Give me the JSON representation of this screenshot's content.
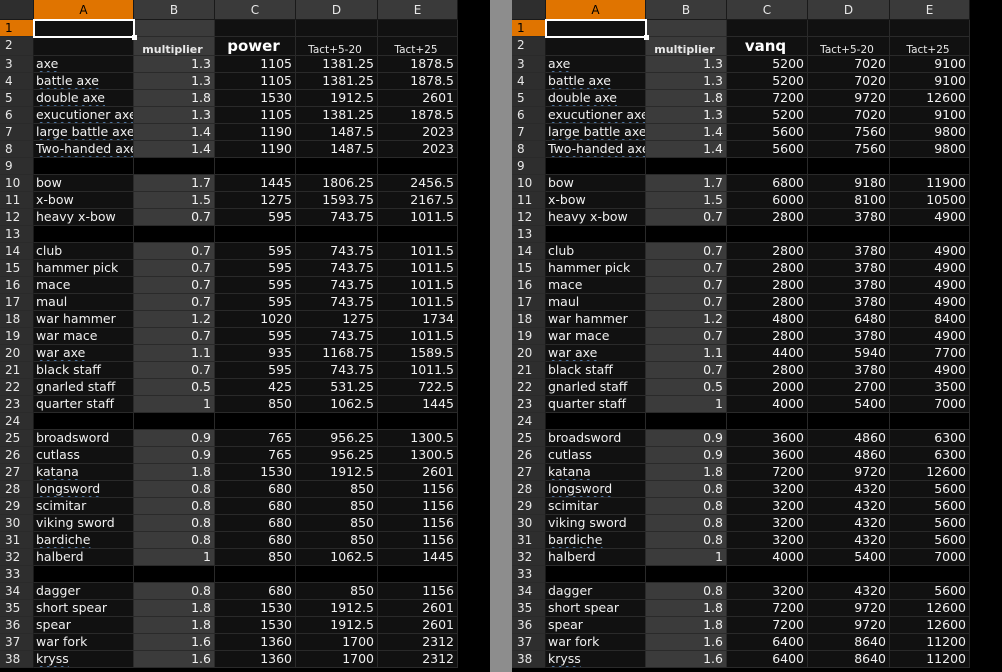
{
  "columns": [
    "A",
    "B",
    "C",
    "D",
    "E"
  ],
  "left": {
    "headers": {
      "b": "multiplier",
      "c": "power",
      "d": "Tact+5-20",
      "e": "Tact+25"
    },
    "rows": [
      {
        "n": "1",
        "a": "",
        "b": "",
        "c": "",
        "d": "",
        "e": ""
      },
      {
        "n": "2",
        "a": "",
        "b": "",
        "c": "",
        "d": "",
        "e": ""
      },
      {
        "n": "3",
        "a": "axe",
        "b": "1.3",
        "c": "1105",
        "d": "1381.25",
        "e": "1878.5",
        "sq": true
      },
      {
        "n": "4",
        "a": "battle axe",
        "b": "1.3",
        "c": "1105",
        "d": "1381.25",
        "e": "1878.5",
        "sq": true
      },
      {
        "n": "5",
        "a": "double axe",
        "b": "1.8",
        "c": "1530",
        "d": "1912.5",
        "e": "2601",
        "sq": true
      },
      {
        "n": "6",
        "a": "exucutioner axe",
        "b": "1.3",
        "c": "1105",
        "d": "1381.25",
        "e": "1878.5",
        "sq": true
      },
      {
        "n": "7",
        "a": "large battle axe",
        "b": "1.4",
        "c": "1190",
        "d": "1487.5",
        "e": "2023",
        "sq": true
      },
      {
        "n": "8",
        "a": "Two-handed axe",
        "b": "1.4",
        "c": "1190",
        "d": "1487.5",
        "e": "2023",
        "sq": true
      },
      {
        "n": "9",
        "a": "",
        "b": "",
        "c": "",
        "d": "",
        "e": "",
        "blank": true
      },
      {
        "n": "10",
        "a": "bow",
        "b": "1.7",
        "c": "1445",
        "d": "1806.25",
        "e": "2456.5"
      },
      {
        "n": "11",
        "a": "x-bow",
        "b": "1.5",
        "c": "1275",
        "d": "1593.75",
        "e": "2167.5"
      },
      {
        "n": "12",
        "a": "heavy x-bow",
        "b": "0.7",
        "c": "595",
        "d": "743.75",
        "e": "1011.5"
      },
      {
        "n": "13",
        "a": "",
        "b": "",
        "c": "",
        "d": "",
        "e": "",
        "blank": true
      },
      {
        "n": "14",
        "a": "club",
        "b": "0.7",
        "c": "595",
        "d": "743.75",
        "e": "1011.5"
      },
      {
        "n": "15",
        "a": "hammer pick",
        "b": "0.7",
        "c": "595",
        "d": "743.75",
        "e": "1011.5"
      },
      {
        "n": "16",
        "a": "mace",
        "b": "0.7",
        "c": "595",
        "d": "743.75",
        "e": "1011.5"
      },
      {
        "n": "17",
        "a": "maul",
        "b": "0.7",
        "c": "595",
        "d": "743.75",
        "e": "1011.5"
      },
      {
        "n": "18",
        "a": "war hammer",
        "b": "1.2",
        "c": "1020",
        "d": "1275",
        "e": "1734"
      },
      {
        "n": "19",
        "a": "war mace",
        "b": "0.7",
        "c": "595",
        "d": "743.75",
        "e": "1011.5"
      },
      {
        "n": "20",
        "a": "war axe",
        "b": "1.1",
        "c": "935",
        "d": "1168.75",
        "e": "1589.5",
        "sq": true
      },
      {
        "n": "21",
        "a": "black staff",
        "b": "0.7",
        "c": "595",
        "d": "743.75",
        "e": "1011.5"
      },
      {
        "n": "22",
        "a": "gnarled staff",
        "b": "0.5",
        "c": "425",
        "d": "531.25",
        "e": "722.5"
      },
      {
        "n": "23",
        "a": "quarter staff",
        "b": "1",
        "c": "850",
        "d": "1062.5",
        "e": "1445"
      },
      {
        "n": "24",
        "a": "",
        "b": "",
        "c": "",
        "d": "",
        "e": "",
        "blank": true
      },
      {
        "n": "25",
        "a": "broadsword",
        "b": "0.9",
        "c": "765",
        "d": "956.25",
        "e": "1300.5"
      },
      {
        "n": "26",
        "a": "cutlass",
        "b": "0.9",
        "c": "765",
        "d": "956.25",
        "e": "1300.5"
      },
      {
        "n": "27",
        "a": "katana",
        "b": "1.8",
        "c": "1530",
        "d": "1912.5",
        "e": "2601",
        "sq": true
      },
      {
        "n": "28",
        "a": "longsword",
        "b": "0.8",
        "c": "680",
        "d": "850",
        "e": "1156",
        "sq": true
      },
      {
        "n": "29",
        "a": "scimitar",
        "b": "0.8",
        "c": "680",
        "d": "850",
        "e": "1156"
      },
      {
        "n": "30",
        "a": "viking sword",
        "b": "0.8",
        "c": "680",
        "d": "850",
        "e": "1156"
      },
      {
        "n": "31",
        "a": "bardiche",
        "b": "0.8",
        "c": "680",
        "d": "850",
        "e": "1156",
        "sq": true
      },
      {
        "n": "32",
        "a": "halberd",
        "b": "1",
        "c": "850",
        "d": "1062.5",
        "e": "1445"
      },
      {
        "n": "33",
        "a": "",
        "b": "",
        "c": "",
        "d": "",
        "e": "",
        "blank": true
      },
      {
        "n": "34",
        "a": "dagger",
        "b": "0.8",
        "c": "680",
        "d": "850",
        "e": "1156"
      },
      {
        "n": "35",
        "a": "short spear",
        "b": "1.8",
        "c": "1530",
        "d": "1912.5",
        "e": "2601"
      },
      {
        "n": "36",
        "a": "spear",
        "b": "1.8",
        "c": "1530",
        "d": "1912.5",
        "e": "2601"
      },
      {
        "n": "37",
        "a": "war fork",
        "b": "1.6",
        "c": "1360",
        "d": "1700",
        "e": "2312"
      },
      {
        "n": "38",
        "a": "kryss",
        "b": "1.6",
        "c": "1360",
        "d": "1700",
        "e": "2312",
        "sq": true
      }
    ]
  },
  "right": {
    "headers": {
      "b": "multiplier",
      "c": "vanq",
      "d": "Tact+5-20",
      "e": "Tact+25"
    },
    "rows": [
      {
        "n": "1",
        "a": "",
        "b": "",
        "c": "",
        "d": "",
        "e": ""
      },
      {
        "n": "2",
        "a": "",
        "b": "",
        "c": "",
        "d": "",
        "e": ""
      },
      {
        "n": "3",
        "a": "axe",
        "b": "1.3",
        "c": "5200",
        "d": "7020",
        "e": "9100",
        "sq": true
      },
      {
        "n": "4",
        "a": "battle axe",
        "b": "1.3",
        "c": "5200",
        "d": "7020",
        "e": "9100",
        "sq": true
      },
      {
        "n": "5",
        "a": "double axe",
        "b": "1.8",
        "c": "7200",
        "d": "9720",
        "e": "12600",
        "sq": true
      },
      {
        "n": "6",
        "a": "exucutioner axe",
        "b": "1.3",
        "c": "5200",
        "d": "7020",
        "e": "9100",
        "sq": true
      },
      {
        "n": "7",
        "a": "large battle axe",
        "b": "1.4",
        "c": "5600",
        "d": "7560",
        "e": "9800",
        "sq": true
      },
      {
        "n": "8",
        "a": "Two-handed axe",
        "b": "1.4",
        "c": "5600",
        "d": "7560",
        "e": "9800",
        "sq": true
      },
      {
        "n": "9",
        "a": "",
        "b": "",
        "c": "",
        "d": "",
        "e": "",
        "blank": true
      },
      {
        "n": "10",
        "a": "bow",
        "b": "1.7",
        "c": "6800",
        "d": "9180",
        "e": "11900"
      },
      {
        "n": "11",
        "a": "x-bow",
        "b": "1.5",
        "c": "6000",
        "d": "8100",
        "e": "10500"
      },
      {
        "n": "12",
        "a": "heavy x-bow",
        "b": "0.7",
        "c": "2800",
        "d": "3780",
        "e": "4900"
      },
      {
        "n": "13",
        "a": "",
        "b": "",
        "c": "",
        "d": "",
        "e": "",
        "blank": true
      },
      {
        "n": "14",
        "a": "club",
        "b": "0.7",
        "c": "2800",
        "d": "3780",
        "e": "4900"
      },
      {
        "n": "15",
        "a": "hammer pick",
        "b": "0.7",
        "c": "2800",
        "d": "3780",
        "e": "4900"
      },
      {
        "n": "16",
        "a": "mace",
        "b": "0.7",
        "c": "2800",
        "d": "3780",
        "e": "4900"
      },
      {
        "n": "17",
        "a": "maul",
        "b": "0.7",
        "c": "2800",
        "d": "3780",
        "e": "4900"
      },
      {
        "n": "18",
        "a": "war hammer",
        "b": "1.2",
        "c": "4800",
        "d": "6480",
        "e": "8400"
      },
      {
        "n": "19",
        "a": "war mace",
        "b": "0.7",
        "c": "2800",
        "d": "3780",
        "e": "4900"
      },
      {
        "n": "20",
        "a": "war axe",
        "b": "1.1",
        "c": "4400",
        "d": "5940",
        "e": "7700",
        "sq": true
      },
      {
        "n": "21",
        "a": "black staff",
        "b": "0.7",
        "c": "2800",
        "d": "3780",
        "e": "4900"
      },
      {
        "n": "22",
        "a": "gnarled staff",
        "b": "0.5",
        "c": "2000",
        "d": "2700",
        "e": "3500"
      },
      {
        "n": "23",
        "a": "quarter staff",
        "b": "1",
        "c": "4000",
        "d": "5400",
        "e": "7000"
      },
      {
        "n": "24",
        "a": "",
        "b": "",
        "c": "",
        "d": "",
        "e": "",
        "blank": true
      },
      {
        "n": "25",
        "a": "broadsword",
        "b": "0.9",
        "c": "3600",
        "d": "4860",
        "e": "6300"
      },
      {
        "n": "26",
        "a": "cutlass",
        "b": "0.9",
        "c": "3600",
        "d": "4860",
        "e": "6300"
      },
      {
        "n": "27",
        "a": "katana",
        "b": "1.8",
        "c": "7200",
        "d": "9720",
        "e": "12600",
        "sq": true
      },
      {
        "n": "28",
        "a": "longsword",
        "b": "0.8",
        "c": "3200",
        "d": "4320",
        "e": "5600",
        "sq": true
      },
      {
        "n": "29",
        "a": "scimitar",
        "b": "0.8",
        "c": "3200",
        "d": "4320",
        "e": "5600"
      },
      {
        "n": "30",
        "a": "viking sword",
        "b": "0.8",
        "c": "3200",
        "d": "4320",
        "e": "5600"
      },
      {
        "n": "31",
        "a": "bardiche",
        "b": "0.8",
        "c": "3200",
        "d": "4320",
        "e": "5600",
        "sq": true
      },
      {
        "n": "32",
        "a": "halberd",
        "b": "1",
        "c": "4000",
        "d": "5400",
        "e": "7000"
      },
      {
        "n": "33",
        "a": "",
        "b": "",
        "c": "",
        "d": "",
        "e": "",
        "blank": true
      },
      {
        "n": "34",
        "a": "dagger",
        "b": "0.8",
        "c": "3200",
        "d": "4320",
        "e": "5600"
      },
      {
        "n": "35",
        "a": "short spear",
        "b": "1.8",
        "c": "7200",
        "d": "9720",
        "e": "12600"
      },
      {
        "n": "36",
        "a": "spear",
        "b": "1.8",
        "c": "7200",
        "d": "9720",
        "e": "12600"
      },
      {
        "n": "37",
        "a": "war fork",
        "b": "1.6",
        "c": "6400",
        "d": "8640",
        "e": "11200"
      },
      {
        "n": "38",
        "a": "kryss",
        "b": "1.6",
        "c": "6400",
        "d": "8640",
        "e": "11200",
        "sq": true
      }
    ]
  }
}
